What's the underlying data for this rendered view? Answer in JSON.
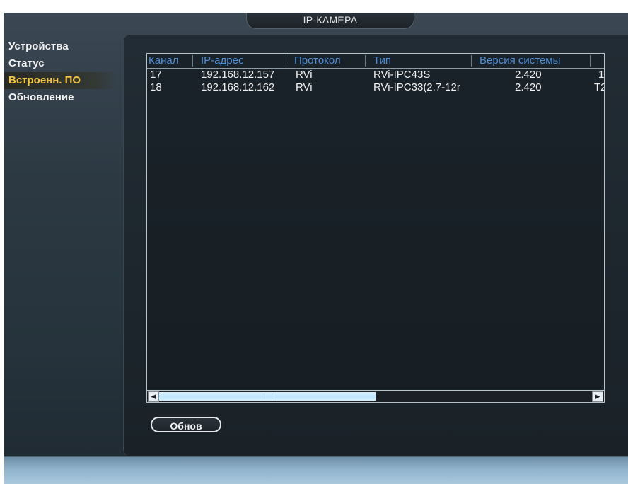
{
  "window": {
    "title": "IP-КАМЕРА"
  },
  "sidebar": {
    "items": [
      {
        "label": "Устройства",
        "active": false
      },
      {
        "label": "Статус",
        "active": false
      },
      {
        "label": "Встроенн. ПО",
        "active": true
      },
      {
        "label": "Обновление",
        "active": false
      }
    ]
  },
  "table": {
    "columns": [
      "Канал",
      "IP-адрес",
      "Протокол",
      "Тип",
      "Версия системы"
    ],
    "rows": [
      {
        "channel": "17",
        "ip": "192.168.12.157",
        "protocol": "RVi",
        "type": "RVi-IPC43S",
        "version": "2.420",
        "extra": "1"
      },
      {
        "channel": "18",
        "ip": "192.168.12.162",
        "protocol": "RVi",
        "type": "RVi-IPC33(2.7-12r",
        "version": "2.420",
        "extra": "T2"
      }
    ]
  },
  "scrollbar": {
    "left_arrow": "◀",
    "right_arrow": "▶",
    "position": 0.0,
    "visible_fraction": 0.5
  },
  "actions": {
    "refresh_label": "Обнов"
  },
  "colors": {
    "active_menu": "#f5c542",
    "column_header": "#4f8fd6",
    "panel_bg": "#1d262d"
  }
}
